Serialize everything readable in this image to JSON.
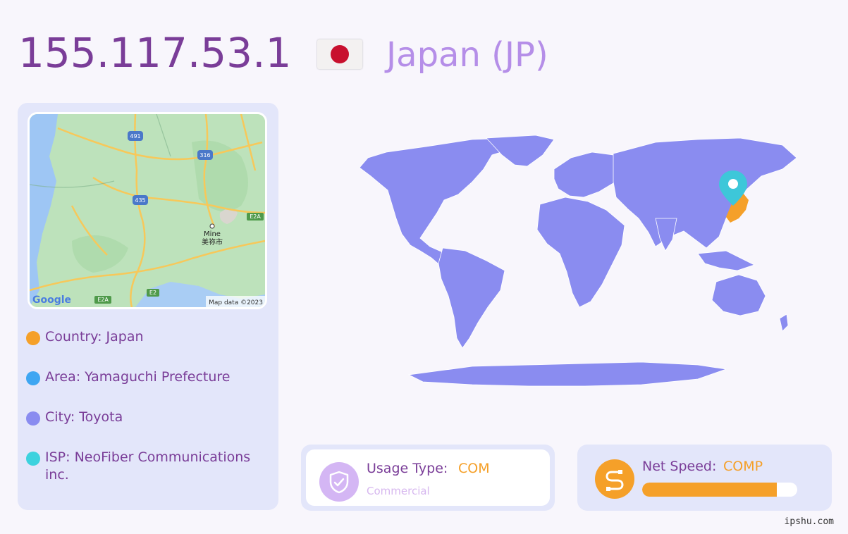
{
  "header": {
    "ip_address": "155.117.53.1",
    "country_title": "Japan (JP)",
    "flag_icon": "japan-flag"
  },
  "mini_map": {
    "city_label_en": "Mine",
    "city_label_jp": "美祢市",
    "road_labels": [
      "491",
      "316",
      "435",
      "E2A",
      "E2",
      "E2A"
    ],
    "logo": "Google",
    "attribution": "Map data ©2023"
  },
  "info": {
    "country": "Country: Japan",
    "area": "Area: Yamaguchi Prefecture",
    "city": "City: Toyota",
    "isp": "ISP: NeoFiber Communications inc.",
    "bullet_colors": [
      "#f5a029",
      "#3ea6f2",
      "#8a8cf0",
      "#3dd2de"
    ]
  },
  "world_map": {
    "land_color": "#8a8cf0",
    "highlight_color": "#f5a029",
    "marker_color": "#3dc7d9",
    "marker_icon": "location-pin-icon"
  },
  "usage": {
    "label": "Usage Type:",
    "value": "COM",
    "sub": "Commercial",
    "icon": "shield-check-icon"
  },
  "speed": {
    "label": "Net Speed:",
    "value": "COMP",
    "icon": "connection-icon",
    "level_fraction": 0.87
  },
  "watermark": "ipshu.com"
}
